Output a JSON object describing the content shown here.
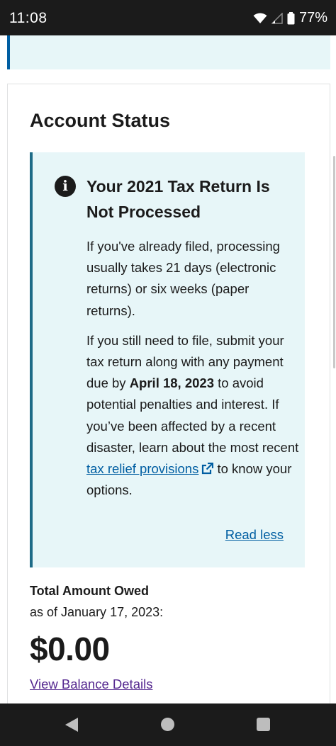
{
  "status_bar": {
    "time": "11:08",
    "battery": "77%",
    "icons": [
      "wifi-icon",
      "signal-icon",
      "battery-icon"
    ]
  },
  "card": {
    "title": "Account Status"
  },
  "alert": {
    "heading": "Your 2021 Tax Return Is Not Processed",
    "para1": "If you've already filed, processing usually takes 21 days (electronic returns) or six weeks (paper returns).",
    "para2_before": "If you still need to file, submit your tax return along with any payment due by ",
    "para2_bold": "April 18, 2023",
    "para2_after": " to avoid potential penalties and interest. If you’ve been affected by a recent disaster, learn about the most recent ",
    "para2_link": "tax relief provisions",
    "para2_end": " to know your options.",
    "read_less": "Read less",
    "icon": "info-icon"
  },
  "balance": {
    "label": "Total Amount Owed",
    "as_of": "as of January 17, 2023:",
    "amount": "$0.00",
    "details_link": "View Balance Details"
  },
  "colors": {
    "alert_bg": "#e7f6f8",
    "link": "#005ea2",
    "visited_link": "#54278f",
    "alert_border": "#1e6b87"
  }
}
